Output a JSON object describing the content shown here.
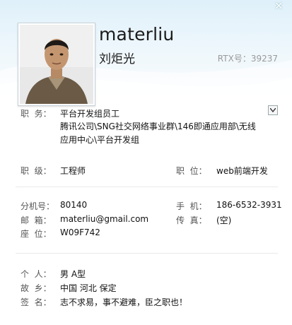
{
  "window": {
    "close_glyph": "×"
  },
  "profile": {
    "username": "materliu",
    "chinese_name": "刘炬光",
    "rtx_label": "RTX号：39237"
  },
  "job": {
    "position_label": "职  务：",
    "position_title": "平台开发组员工",
    "department": "腾讯公司\\SNG社交网络事业群\\146即通应用部\\无线应用中心\\平台开发组"
  },
  "rank": {
    "level_label": "职  级：",
    "level_value": "工程师",
    "post_label": "职  位：",
    "post_value": "web前端开发"
  },
  "contact": {
    "ext_label": "分机号：",
    "ext_value": "80140",
    "mobile_label": "手  机：",
    "mobile_value": "186-6532-3931",
    "email_label": "邮  箱：",
    "email_value": "materliu@gmail.com",
    "fax_label": "传  真：",
    "fax_value": "(空)",
    "seat_label": "座  位：",
    "seat_value": "W09F742"
  },
  "personal": {
    "person_label": "个  人：",
    "person_value": "男 A型",
    "hometown_label": "故  乡：",
    "hometown_value": "中国 河北 保定",
    "signature_label": "签  名：",
    "signature_value": "志不求易，事不避难，臣之职也！"
  }
}
